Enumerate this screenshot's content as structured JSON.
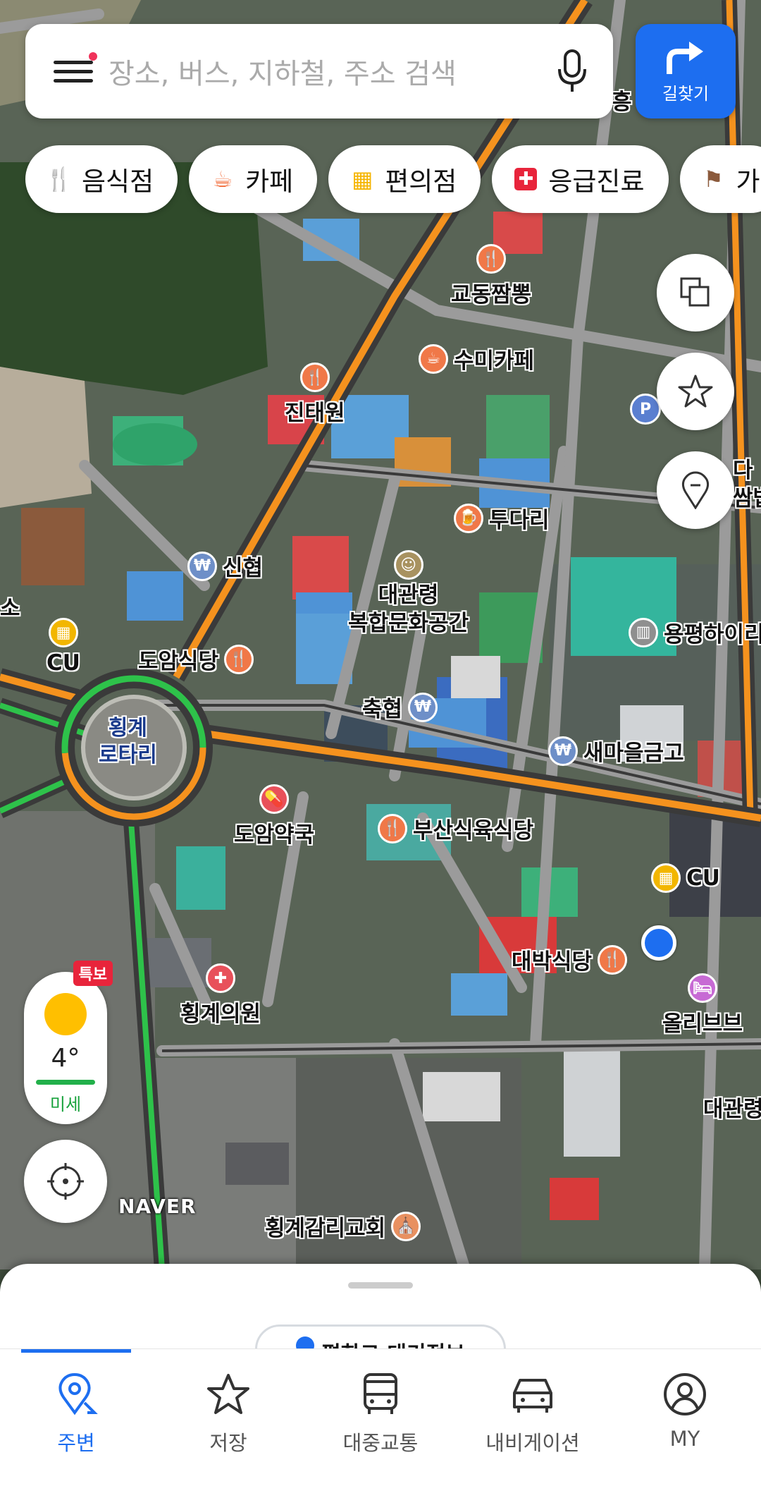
{
  "search": {
    "placeholder": "장소, 버스, 지하철, 주소 검색",
    "directions_label": "길찾기"
  },
  "chips": [
    {
      "label": "음식점",
      "icon": "fork-knife-icon",
      "color": "#f26b38"
    },
    {
      "label": "카페",
      "icon": "coffee-cup-icon",
      "color": "#f26b38"
    },
    {
      "label": "편의점",
      "icon": "store-icon",
      "color": "#f5b400"
    },
    {
      "label": "응급진료",
      "icon": "medical-cross-icon",
      "color": "#e8243b"
    },
    {
      "label": "가",
      "icon": "flag-icon",
      "color": "#8b5a3c"
    }
  ],
  "map": {
    "pois": [
      {
        "name": "교동짬뽕",
        "type": "restaurant"
      },
      {
        "name": "수미카페",
        "type": "cafe"
      },
      {
        "name": "진태원",
        "type": "restaurant"
      },
      {
        "name": "투다리",
        "type": "bar"
      },
      {
        "name": "신협",
        "type": "bank"
      },
      {
        "name": "대관령\n복합문화공간",
        "type": "culture"
      },
      {
        "name": "CU",
        "type": "convenience"
      },
      {
        "name": "도암식당",
        "type": "restaurant"
      },
      {
        "name": "축협",
        "type": "bank"
      },
      {
        "name": "용평하이리",
        "type": "building"
      },
      {
        "name": "새마을금고",
        "type": "bank"
      },
      {
        "name": "도암약국",
        "type": "pharmacy"
      },
      {
        "name": "부산식육식당",
        "type": "restaurant"
      },
      {
        "name": "CU",
        "type": "convenience"
      },
      {
        "name": "대박식당",
        "type": "restaurant"
      },
      {
        "name": "횡계의원",
        "type": "hospital"
      },
      {
        "name": "올리브브",
        "type": "lodging"
      },
      {
        "name": "대관령",
        "type": "partial"
      },
      {
        "name": "횡계감리교회",
        "type": "church"
      },
      {
        "name": "다",
        "type": "partial"
      },
      {
        "name": "쌈밥",
        "type": "partial"
      },
      {
        "name": "흥",
        "type": "partial"
      },
      {
        "name": "소",
        "type": "partial"
      },
      {
        "name": "P",
        "type": "parking"
      }
    ],
    "rotary_label": "횡계\n로타리",
    "logo": "NAVER"
  },
  "weather": {
    "alert": "특보",
    "temperature": "4°",
    "dust": "미세"
  },
  "sheet": {
    "peek_text": "편한그 대기정보"
  },
  "nav": [
    {
      "label": "주변",
      "icon": "nearby-pin-icon",
      "active": true
    },
    {
      "label": "저장",
      "icon": "star-icon",
      "active": false
    },
    {
      "label": "대중교통",
      "icon": "bus-icon",
      "active": false
    },
    {
      "label": "내비게이션",
      "icon": "car-icon",
      "active": false
    },
    {
      "label": "MY",
      "icon": "profile-icon",
      "active": false
    }
  ],
  "colors": {
    "accent": "#1d6ef0",
    "road_main": "#f5921e",
    "road_green": "#2ec24a"
  }
}
